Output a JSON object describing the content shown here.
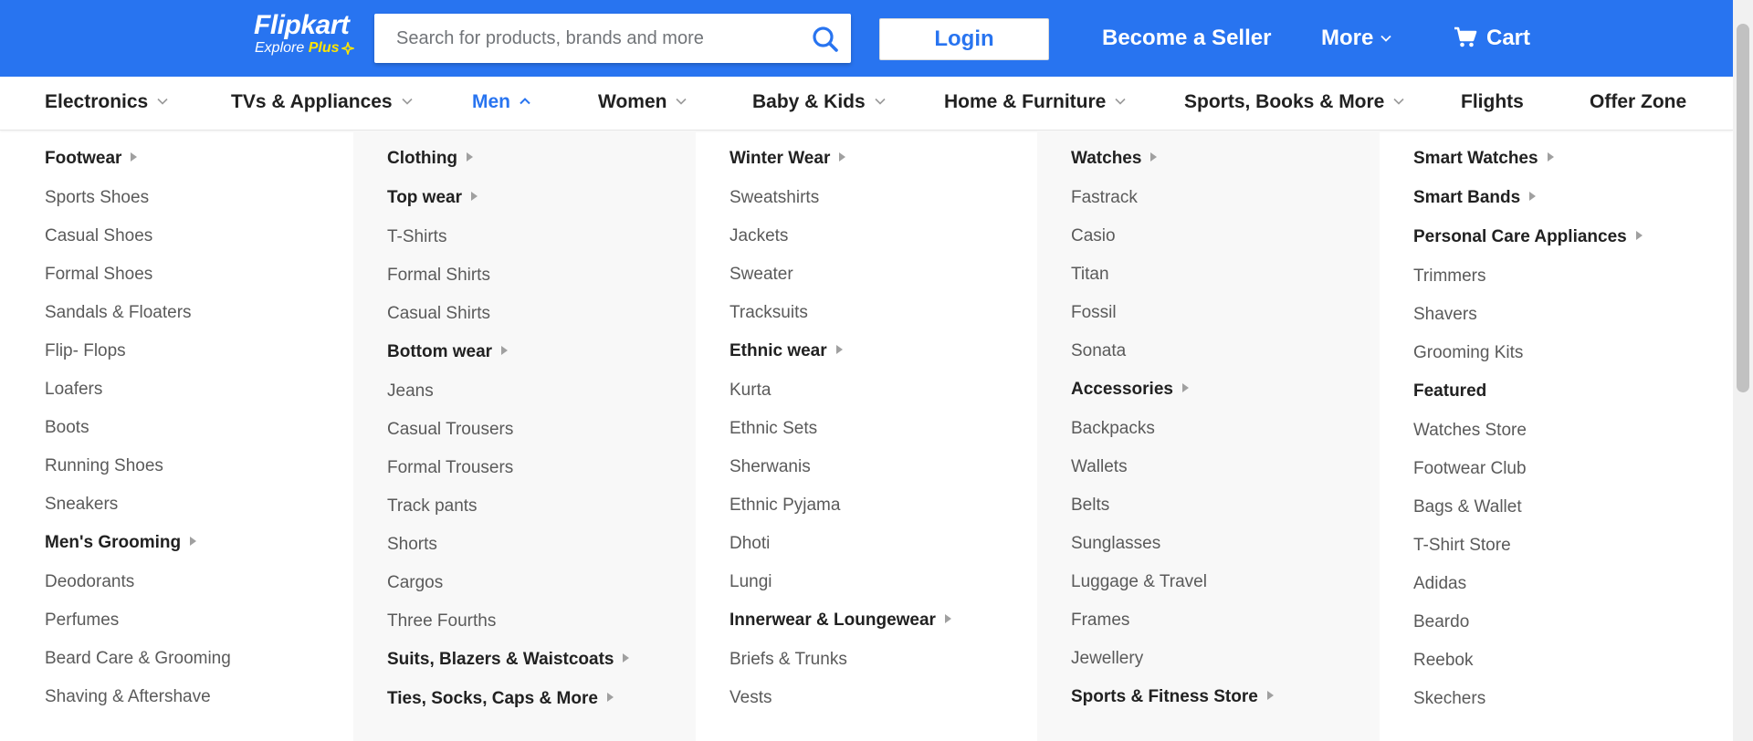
{
  "header": {
    "logo_word": "Flipkart",
    "logo_explore": "Explore",
    "logo_plus": "Plus",
    "search_placeholder": "Search for products, brands and more",
    "login_label": "Login",
    "seller_label": "Become a Seller",
    "more_label": "More",
    "cart_label": "Cart",
    "brand_color": "#2874f0",
    "accent_color": "#ffe500"
  },
  "categories": [
    {
      "label": "Electronics",
      "dropdown": true
    },
    {
      "label": "TVs & Appliances",
      "dropdown": true
    },
    {
      "label": "Men",
      "dropdown": true,
      "active": true
    },
    {
      "label": "Women",
      "dropdown": true
    },
    {
      "label": "Baby & Kids",
      "dropdown": true
    },
    {
      "label": "Home & Furniture",
      "dropdown": true
    },
    {
      "label": "Sports, Books & More",
      "dropdown": true
    },
    {
      "label": "Flights",
      "dropdown": false
    },
    {
      "label": "Offer Zone",
      "dropdown": false
    }
  ],
  "menu": {
    "columns": [
      {
        "items": [
          {
            "label": "Footwear",
            "heading": true
          },
          {
            "label": "Sports Shoes"
          },
          {
            "label": "Casual Shoes"
          },
          {
            "label": "Formal Shoes"
          },
          {
            "label": "Sandals & Floaters"
          },
          {
            "label": "Flip- Flops"
          },
          {
            "label": "Loafers"
          },
          {
            "label": "Boots"
          },
          {
            "label": "Running Shoes"
          },
          {
            "label": "Sneakers"
          },
          {
            "label": "Men's Grooming",
            "heading": true
          },
          {
            "label": "Deodorants"
          },
          {
            "label": "Perfumes"
          },
          {
            "label": "Beard Care & Grooming"
          },
          {
            "label": "Shaving & Aftershave"
          }
        ]
      },
      {
        "items": [
          {
            "label": "Clothing",
            "heading": true
          },
          {
            "label": "Top wear",
            "heading": true
          },
          {
            "label": "T-Shirts"
          },
          {
            "label": "Formal Shirts"
          },
          {
            "label": "Casual Shirts"
          },
          {
            "label": "Bottom wear",
            "heading": true
          },
          {
            "label": "Jeans"
          },
          {
            "label": "Casual Trousers"
          },
          {
            "label": "Formal Trousers"
          },
          {
            "label": "Track pants"
          },
          {
            "label": "Shorts"
          },
          {
            "label": "Cargos"
          },
          {
            "label": "Three Fourths"
          },
          {
            "label": "Suits, Blazers & Waistcoats",
            "heading": true
          },
          {
            "label": "Ties, Socks, Caps & More",
            "heading": true
          }
        ]
      },
      {
        "items": [
          {
            "label": "Winter Wear",
            "heading": true
          },
          {
            "label": "Sweatshirts"
          },
          {
            "label": "Jackets"
          },
          {
            "label": "Sweater"
          },
          {
            "label": "Tracksuits"
          },
          {
            "label": "Ethnic wear",
            "heading": true
          },
          {
            "label": "Kurta"
          },
          {
            "label": "Ethnic Sets"
          },
          {
            "label": "Sherwanis"
          },
          {
            "label": "Ethnic Pyjama"
          },
          {
            "label": "Dhoti"
          },
          {
            "label": "Lungi"
          },
          {
            "label": "Innerwear & Loungewear",
            "heading": true
          },
          {
            "label": "Briefs & Trunks"
          },
          {
            "label": "Vests"
          }
        ]
      },
      {
        "items": [
          {
            "label": "Watches",
            "heading": true
          },
          {
            "label": "Fastrack"
          },
          {
            "label": "Casio"
          },
          {
            "label": "Titan"
          },
          {
            "label": "Fossil"
          },
          {
            "label": "Sonata"
          },
          {
            "label": "Accessories",
            "heading": true
          },
          {
            "label": "Backpacks"
          },
          {
            "label": "Wallets"
          },
          {
            "label": "Belts"
          },
          {
            "label": "Sunglasses"
          },
          {
            "label": "Luggage & Travel"
          },
          {
            "label": "Frames"
          },
          {
            "label": "Jewellery"
          },
          {
            "label": "Sports & Fitness Store",
            "heading": true
          }
        ]
      },
      {
        "items": [
          {
            "label": "Smart Watches",
            "heading": true
          },
          {
            "label": "Smart Bands",
            "heading": true
          },
          {
            "label": "Personal Care Appliances",
            "heading": true
          },
          {
            "label": "Trimmers"
          },
          {
            "label": "Shavers"
          },
          {
            "label": "Grooming Kits"
          },
          {
            "label": "Featured",
            "heading": true,
            "noarrow": true
          },
          {
            "label": "Watches Store"
          },
          {
            "label": "Footwear Club"
          },
          {
            "label": "Bags & Wallet"
          },
          {
            "label": "T-Shirt Store"
          },
          {
            "label": "Adidas"
          },
          {
            "label": "Beardo"
          },
          {
            "label": "Reebok"
          },
          {
            "label": "Skechers"
          }
        ]
      }
    ]
  }
}
